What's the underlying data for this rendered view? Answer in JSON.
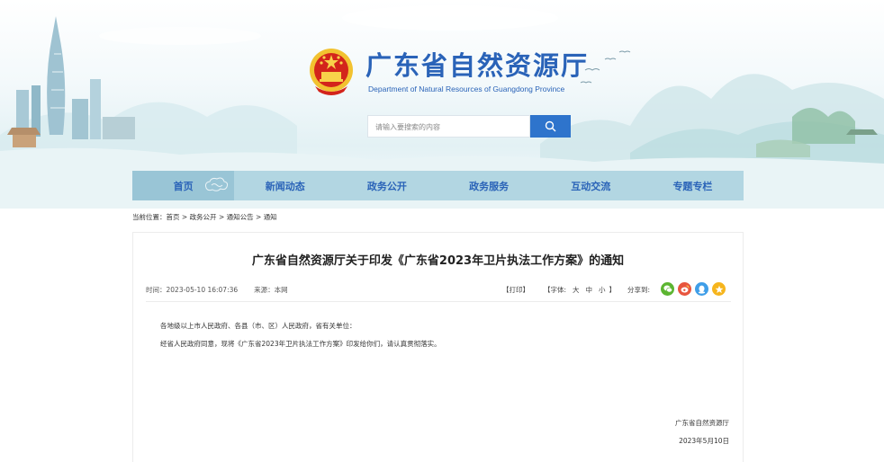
{
  "site": {
    "title": "广东省自然资源厅",
    "subtitle": "Department of Natural Resources of Guangdong Province"
  },
  "search": {
    "placeholder": "请输入要搜索的内容"
  },
  "nav": {
    "items": [
      {
        "label": "首页"
      },
      {
        "label": "新闻动态"
      },
      {
        "label": "政务公开"
      },
      {
        "label": "政务服务"
      },
      {
        "label": "互动交流"
      },
      {
        "label": "专题专栏"
      }
    ]
  },
  "breadcrumb": {
    "prefix": "当前位置：",
    "items": [
      "首页",
      "政务公开",
      "通知公告",
      "通知"
    ],
    "separator": " > "
  },
  "article": {
    "title": "广东省自然资源厅关于印发《广东省2023年卫片执法工作方案》的通知",
    "time": "时间：2023-05-10 16:07:36",
    "source": "来源：本网",
    "print_label": "【打印】",
    "font_size_label": "【字体:",
    "font_sizes": [
      "大",
      "中",
      "小"
    ],
    "font_size_close": "】",
    "share_label": "分享到:",
    "share_targets": [
      "wechat-icon",
      "weibo-icon",
      "qq-icon",
      "qzone-icon"
    ],
    "paragraphs": [
      "各地级以上市人民政府、各县（市、区）人民政府，省有关单位：",
      "经省人民政府同意，现将《广东省2023年卫片执法工作方案》印发给你们，请认真贯彻落实。"
    ],
    "signature_org": "广东省自然资源厅",
    "signature_date": "2023年5月10日"
  },
  "colors": {
    "brand_blue": "#2a63b8",
    "search_button": "#2e74cc",
    "nav_bg": "#add2e0"
  }
}
